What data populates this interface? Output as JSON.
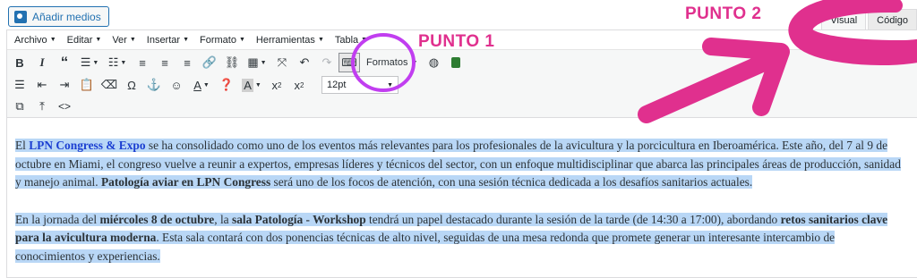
{
  "media_button": {
    "label": "Añadir medios",
    "icon": "media-icon"
  },
  "tabs": [
    {
      "label": "Visual",
      "active": true
    },
    {
      "label": "Código",
      "active": false
    }
  ],
  "menubar": [
    "Archivo",
    "Editar",
    "Ver",
    "Insertar",
    "Formato",
    "Herramientas",
    "Tabla"
  ],
  "toolbar": {
    "formats_label": "Formatos",
    "font_size_value": "12pt",
    "row1": [
      "bold-icon",
      "italic-icon",
      "blockquote-icon",
      "bullet-list-icon",
      "numbered-list-icon",
      "align-left-icon",
      "align-center-icon",
      "align-right-icon",
      "link-icon",
      "unlink-icon",
      "table-icon",
      "fullscreen-icon",
      "undo-icon",
      "redo-icon",
      "keyboard-icon"
    ],
    "row2": [
      "justify-icon",
      "outdent-icon",
      "indent-icon",
      "paste-text-icon",
      "clear-format-icon",
      "omega-icon",
      "anchor-icon",
      "emoji-icon",
      "text-color-icon",
      "help-icon",
      "background-color-icon",
      "subscript-icon",
      "superscript-icon"
    ],
    "row3": [
      "find-icon",
      "upload-icon",
      "code-icon"
    ]
  },
  "annotations": {
    "punto1": "PUNTO 1",
    "punto2": "PUNTO 2",
    "color": "#e0308e"
  },
  "content": {
    "p1": {
      "a": "El ",
      "b": "LPN Congress & Expo",
      "c": " se ha consolidado como uno de los eventos más relevantes para los profesionales de la avicultura y la porcicultura en Iberoamérica. Este año, del 7 al 9 de octubre en Miami, el congreso vuelve a reunir a expertos, empresas líderes y técnicos del sector, con un enfoque multidisciplinar que abarca las principales áreas de producción, sanidad y manejo animal. ",
      "d": "Patología aviar en LPN Congress",
      "e": " será uno de los focos de atención, con una sesión técnica dedicada a los desafíos sanitarios actuales."
    },
    "p2": {
      "a": "En la jornada del ",
      "b": "miércoles 8 de octubre",
      "c": ", la ",
      "d": "sala Patología - Workshop",
      "e": " tendrá un papel destacado durante la sesión de la tarde (de 14:30 a 17:00), abordando ",
      "f": "retos sanitarios clave para la avicultura moderna",
      "g": ". Esta sala contará con dos ponencias técnicas de alto nivel, seguidas de una mesa redonda que promete generar un interesante intercambio de conocimientos y experiencias."
    }
  }
}
